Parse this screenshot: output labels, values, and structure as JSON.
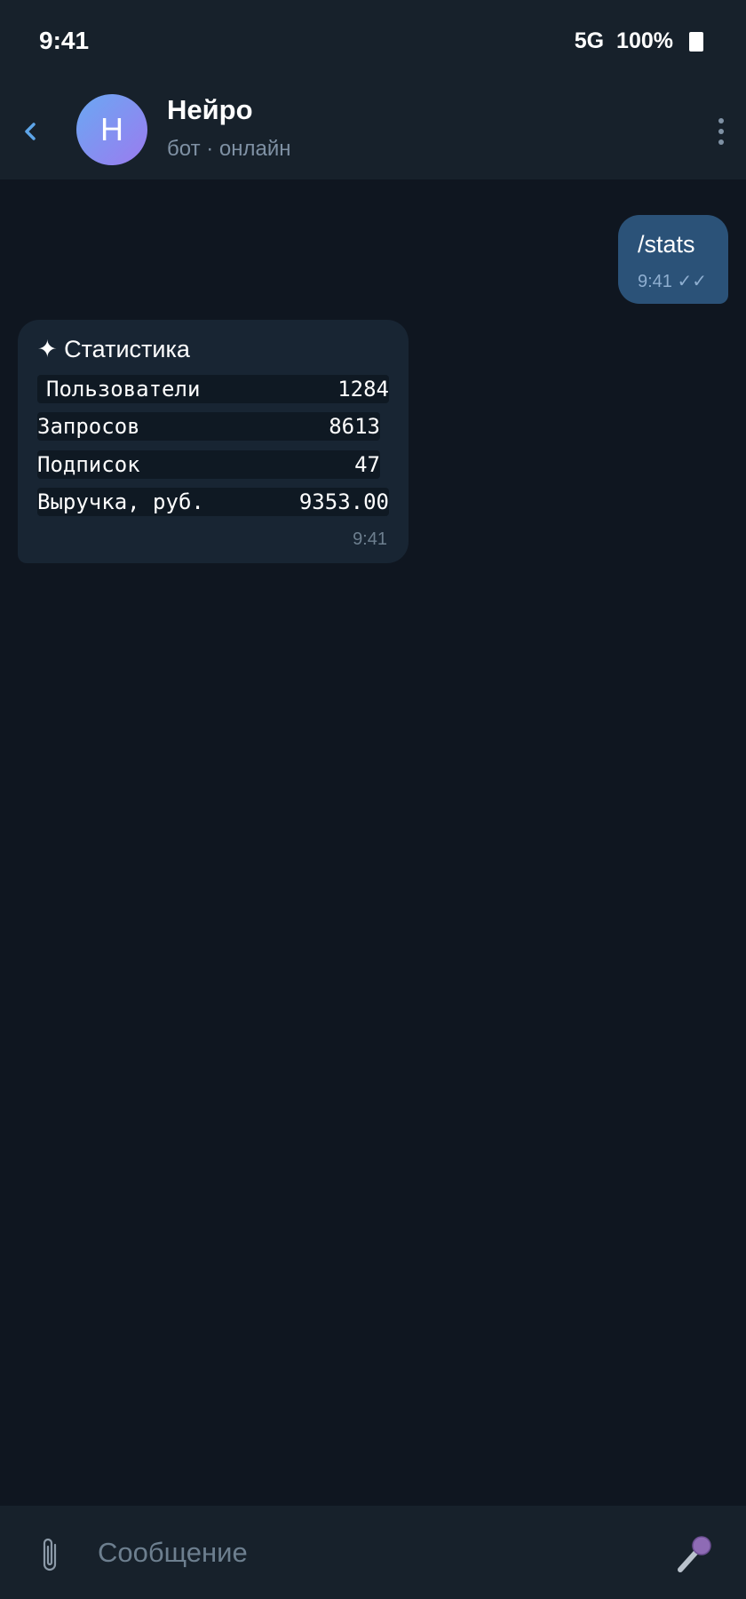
{
  "status_bar": {
    "time": "9:41",
    "network": "5G",
    "battery": "100%"
  },
  "header": {
    "avatar_letter": "Н",
    "title": "Нейро",
    "subtitle": "бот · онлайн",
    "back_icon": "chevron-left-icon",
    "menu_icon": "more-vertical-icon"
  },
  "messages": [
    {
      "direction": "out",
      "text": "/stats",
      "time": "9:41",
      "status_icon": "✓✓"
    },
    {
      "direction": "in",
      "title": "✦ Статистика",
      "rows": [
        {
          "label": "Пользователи",
          "value": "1284"
        },
        {
          "label": "Запросов",
          "value": "8613"
        },
        {
          "label": "Подписок",
          "value": "47"
        },
        {
          "label": "Выручка, руб.",
          "value": "9353.00"
        }
      ],
      "time": "9:41"
    }
  ],
  "composer": {
    "placeholder": "Сообщение",
    "attach_icon": "paperclip-icon",
    "mic_icon": "microphone-icon"
  },
  "colors": {
    "background": "#0f1620",
    "bar": "#17212b",
    "outgoing_bubble": "#2b5278",
    "incoming_bubble": "#182533",
    "accent": "#5ea5e8",
    "muted_text": "#7f91a4"
  }
}
